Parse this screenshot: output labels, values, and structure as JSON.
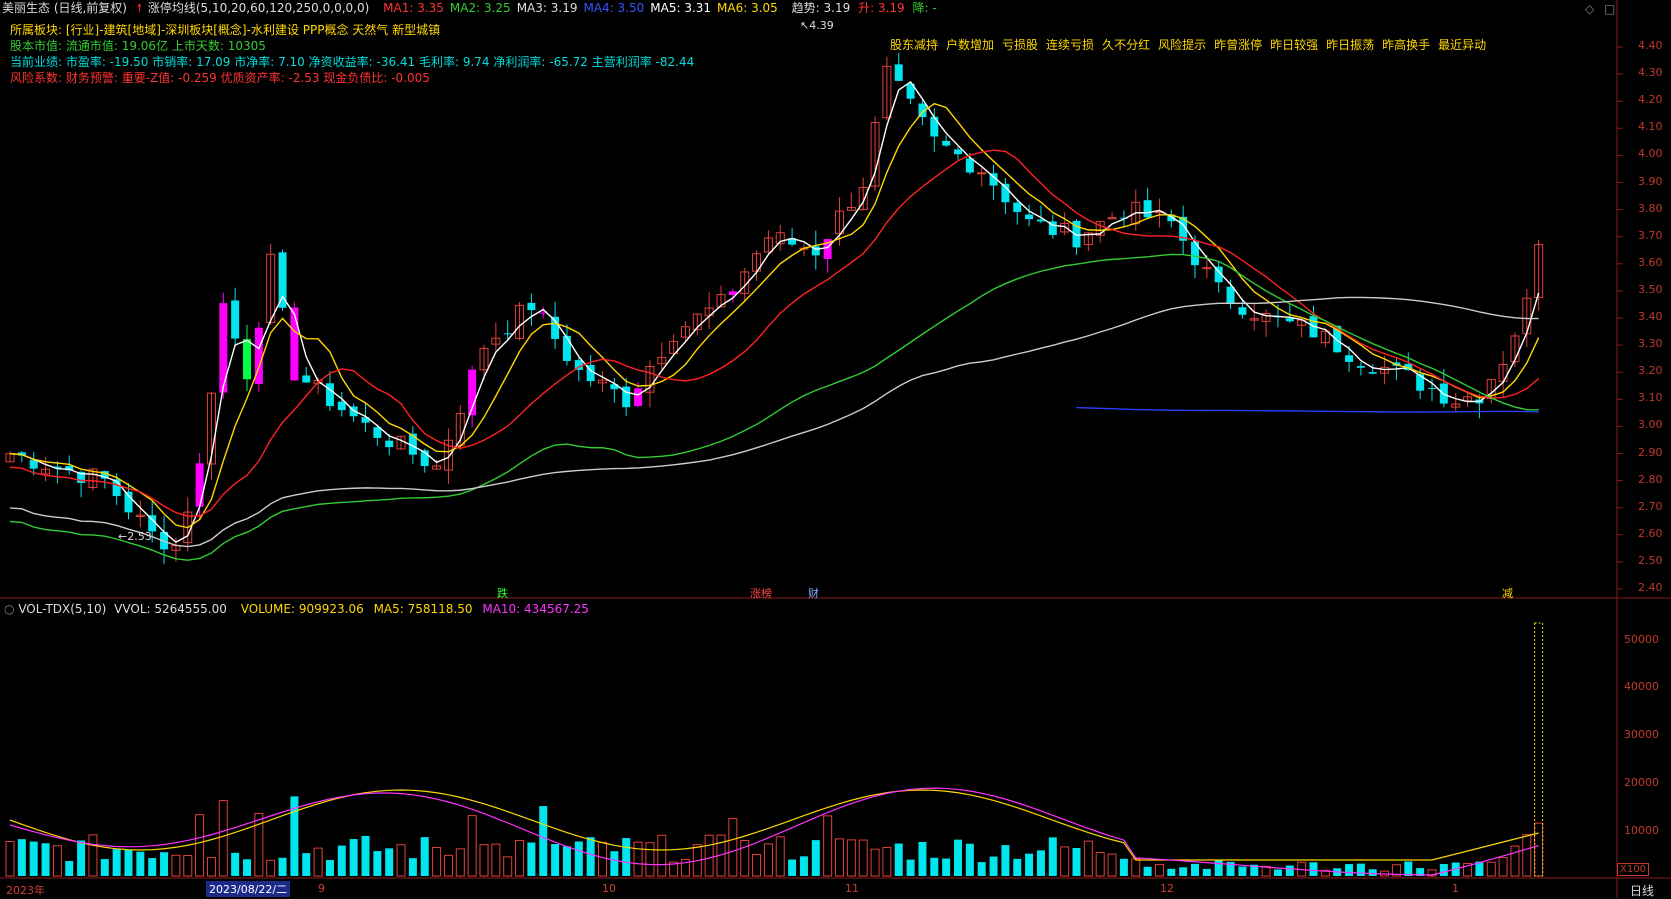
{
  "header": {
    "stock_name": "美丽生态 (日线,前复权)",
    "indicator_name": "涨停均线(5,10,20,60,120,250,0,0,0,0)",
    "ma": [
      {
        "label": "MA1: 3.35",
        "color": "#ff3333"
      },
      {
        "label": "MA2: 3.25",
        "color": "#33cc33"
      },
      {
        "label": "MA3: 3.19",
        "color": "#dddddd"
      },
      {
        "label": "MA4: 3.50",
        "color": "#3355ff"
      },
      {
        "label": "MA5: 3.31",
        "color": "#ffffff"
      },
      {
        "label": "MA6: 3.05",
        "color": "#ffd700"
      }
    ],
    "trend_label": "趋势: 3.19",
    "up_label": "升: 3.19",
    "down_label": "降: -"
  },
  "info": {
    "sector": "所属板块: [行业]-建筑[地域]-深圳板块[概念]-水利建设 PPP概念 天然气 新型城镇",
    "market": "股本市值:  流通市值: 19.06亿  上市天数: 10305",
    "perf": "当前业绩: 市盈率: -19.50 市销率: 17.09 市净率: 7.10 净资收益率: -36.41 毛利率: 9.74 净利润率: -65.72 主营利润率 -82.44",
    "risk": "风险系数: 财务预警: 重要-Z值: -0.259 优质资产率: -2.53 现金负债比: -0.005"
  },
  "tags": [
    "股东减持",
    "户数增加",
    "亏损股",
    "连续亏损",
    "久不分红",
    "风险提示",
    "昨曾涨停",
    "昨日较强",
    "昨日振荡",
    "昨高换手",
    "最近异动"
  ],
  "price_axis": [
    "4.40",
    "4.30",
    "4.20",
    "4.10",
    "4.00",
    "3.90",
    "3.80",
    "3.70",
    "3.60",
    "3.50",
    "3.40",
    "3.30",
    "3.20",
    "3.10",
    "3.00",
    "2.90",
    "2.80",
    "2.70",
    "2.60",
    "2.50",
    "2.40"
  ],
  "annotations": {
    "high": "4.39",
    "low": "2.53"
  },
  "event_markers": [
    {
      "text": "跌",
      "color": "#33ff33"
    },
    {
      "text": "涨榜",
      "color": "#ff4444"
    },
    {
      "text": "财",
      "color": "#88aaff"
    },
    {
      "text": "减",
      "color": "#ffd700"
    }
  ],
  "volume": {
    "title": "VOL-TDX(5,10)",
    "vvol": "VVOL: 5264555.00",
    "volume": "VOLUME: 909923.06",
    "ma5": "MA5: 758118.50",
    "ma10": "MA10: 434567.25",
    "axis": [
      "50000",
      "40000",
      "30000",
      "20000",
      "10000"
    ],
    "unit": "X100"
  },
  "time_axis": {
    "year": "2023年",
    "cursor_date": "2023/08/22/二",
    "months": [
      "9",
      "10",
      "11",
      "12",
      "1"
    ],
    "period": "日线"
  },
  "icons": [
    "diamond-icon",
    "square-icon",
    "red-up-arrow-icon"
  ],
  "colors": {
    "up": "#e0413a",
    "down": "#00e5ee",
    "limit_up": "#ff00ff",
    "limit_down": "#00ff44"
  }
}
